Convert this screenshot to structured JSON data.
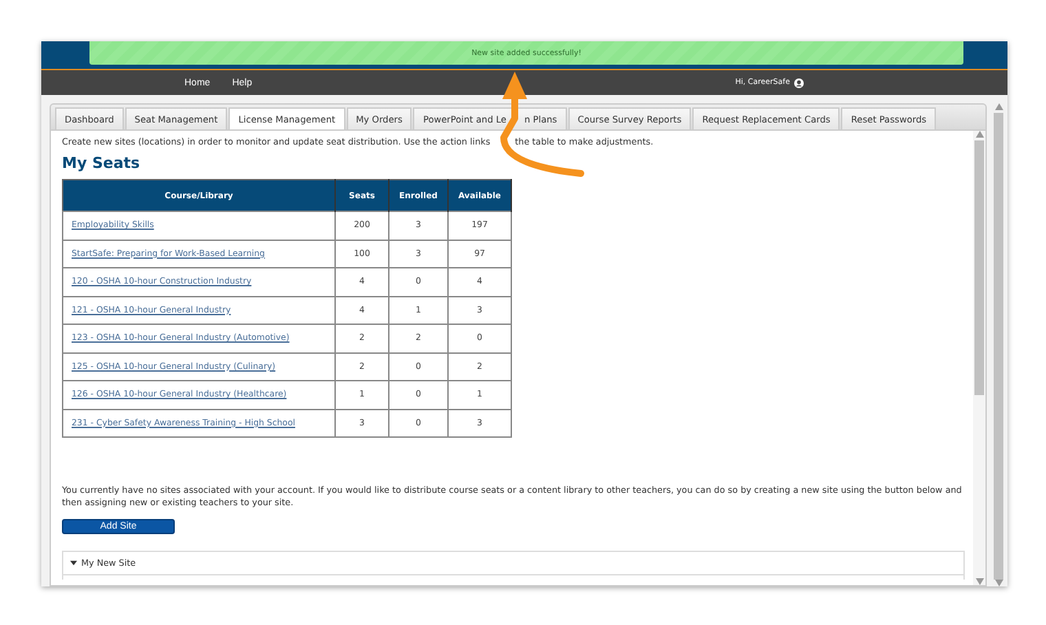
{
  "notification": {
    "text": "New site added successfully!"
  },
  "nav": {
    "links": [
      "Home",
      "Help"
    ],
    "greeting": "Hi, CareerSafe"
  },
  "tabs": [
    {
      "label": "Dashboard",
      "selected": false
    },
    {
      "label": "Seat Management",
      "selected": false
    },
    {
      "label": "License Management",
      "selected": true
    },
    {
      "label": "My Orders",
      "selected": false
    },
    {
      "label": "PowerPoint and Le",
      "label_after": "n Plans",
      "selected": false
    },
    {
      "label": "Course Survey Reports",
      "selected": false
    },
    {
      "label": "Request Replacement Cards",
      "selected": false
    },
    {
      "label": "Reset Passwords",
      "selected": false
    }
  ],
  "intro": [
    "Create new sites (locations) in order to monitor and update seat distribution. Use the action links",
    "the table to make adjustments."
  ],
  "heading": "My Seats",
  "table": {
    "columns": [
      "Course/Library",
      "Seats",
      "Enrolled",
      "Available"
    ],
    "rows": [
      [
        "Employability Skills",
        "200",
        "3",
        "197"
      ],
      [
        "StartSafe: Preparing for Work-Based Learning",
        "100",
        "3",
        "97"
      ],
      [
        "120 - OSHA 10-hour Construction Industry",
        "4",
        "0",
        "4"
      ],
      [
        "121 - OSHA 10-hour General Industry",
        "4",
        "1",
        "3"
      ],
      [
        "123 - OSHA 10-hour General Industry (Automotive)",
        "2",
        "2",
        "0"
      ],
      [
        "125 - OSHA 10-hour General Industry (Culinary)",
        "2",
        "0",
        "2"
      ],
      [
        "126 - OSHA 10-hour General Industry (Healthcare)",
        "1",
        "0",
        "1"
      ],
      [
        "231 - Cyber Safety Awareness Training - High School",
        "3",
        "0",
        "3"
      ]
    ]
  },
  "sites_note": "You currently have no sites associated with your account. If you would like to distribute course seats or a content library to other teachers, you can do so by creating a new site using the button below and then assigning new or existing teachers to your site.",
  "add_button": "Add Site",
  "site_panel": {
    "title": "My New Site",
    "expanded": true
  }
}
